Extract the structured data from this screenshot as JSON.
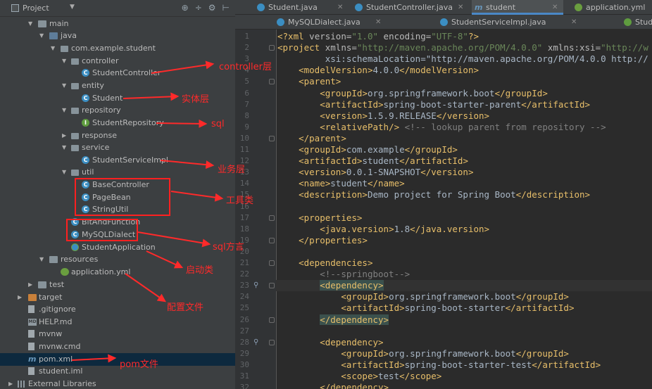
{
  "project_panel": {
    "title": "Project",
    "header_icons": [
      "globe-icon",
      "divide-icon",
      "gear-icon",
      "hide-icon"
    ],
    "tree": [
      {
        "label": "main",
        "icon": "folder-icon"
      },
      {
        "label": "java",
        "icon": "source-folder-icon"
      },
      {
        "label": "com.example.student",
        "icon": "package-icon"
      },
      {
        "label": "controller",
        "icon": "package-icon"
      },
      {
        "label": "StudentController",
        "icon": "class-icon"
      },
      {
        "label": "entity",
        "icon": "package-icon"
      },
      {
        "label": "Student",
        "icon": "class-icon"
      },
      {
        "label": "repository",
        "icon": "package-icon"
      },
      {
        "label": "StudentRepository",
        "icon": "interface-icon"
      },
      {
        "label": "response",
        "icon": "package-icon"
      },
      {
        "label": "service",
        "icon": "package-icon"
      },
      {
        "label": "StudentServiceImpl",
        "icon": "class-icon"
      },
      {
        "label": "util",
        "icon": "package-icon"
      },
      {
        "label": "BaseController",
        "icon": "class-icon"
      },
      {
        "label": "PageBean",
        "icon": "class-icon"
      },
      {
        "label": "StringUtil",
        "icon": "class-icon"
      },
      {
        "label": "BitAndFunction",
        "icon": "class-icon"
      },
      {
        "label": "MySQLDialect",
        "icon": "class-icon"
      },
      {
        "label": "StudentApplication",
        "icon": "spring-app-icon"
      },
      {
        "label": "resources",
        "icon": "resources-folder-icon"
      },
      {
        "label": "application.yml",
        "icon": "yaml-icon"
      },
      {
        "label": "test",
        "icon": "folder-icon"
      },
      {
        "label": "target",
        "icon": "excluded-folder-icon"
      },
      {
        "label": ".gitignore",
        "icon": "file-icon"
      },
      {
        "label": "HELP.md",
        "icon": "markdown-icon"
      },
      {
        "label": "mvnw",
        "icon": "file-icon"
      },
      {
        "label": "mvnw.cmd",
        "icon": "file-icon"
      },
      {
        "label": "pom.xml",
        "icon": "maven-icon"
      },
      {
        "label": "student.iml",
        "icon": "file-icon"
      },
      {
        "label": "External Libraries",
        "icon": "library-icon"
      }
    ],
    "selected_item": "pom.xml"
  },
  "annotations": {
    "controller": "controller层",
    "entity": "实体层",
    "repository": "sql",
    "service": "业务层",
    "util": "工具类",
    "dialect": "sql方言",
    "application": "启动类",
    "config": "配置文件",
    "pom": "pom文件",
    "color": "#ff2a2a"
  },
  "editor": {
    "tabs_row1": [
      {
        "label": "Student.java",
        "icon": "class-icon"
      },
      {
        "label": "StudentController.java",
        "icon": "class-icon"
      },
      {
        "label": "student",
        "icon": "maven-icon",
        "active": true
      },
      {
        "label": "application.yml",
        "icon": "yaml-icon"
      }
    ],
    "tabs_row2": [
      {
        "label": "MySQLDialect.java",
        "icon": "class-icon"
      },
      {
        "label": "StudentServiceImpl.java",
        "icon": "class-icon"
      },
      {
        "label": "Stud",
        "icon": "interface-icon"
      }
    ],
    "line_numbers": [
      "1",
      "2",
      "3",
      "4",
      "5",
      "6",
      "7",
      "8",
      "9",
      "10",
      "11",
      "12",
      "13",
      "14",
      "15",
      "16",
      "17",
      "18",
      "19",
      "20",
      "21",
      "22",
      "23",
      "24",
      "25",
      "26",
      "27",
      "28",
      "29",
      "30",
      "31",
      "32"
    ],
    "code_lines": [
      "<?xml version=\"1.0\" encoding=\"UTF-8\"?>",
      "<project xmlns=\"http://maven.apache.org/POM/4.0.0\" xmlns:xsi=\"http://w",
      "         xsi:schemaLocation=\"http://maven.apache.org/POM/4.0.0 http://",
      "    <modelVersion>4.0.0</modelVersion>",
      "    <parent>",
      "        <groupId>org.springframework.boot</groupId>",
      "        <artifactId>spring-boot-starter-parent</artifactId>",
      "        <version>1.5.9.RELEASE</version>",
      "        <relativePath/> <!-- lookup parent from repository -->",
      "    </parent>",
      "    <groupId>com.example</groupId>",
      "    <artifactId>student</artifactId>",
      "    <version>0.0.1-SNAPSHOT</version>",
      "    <name>student</name>",
      "    <description>Demo project for Spring Boot</description>",
      "",
      "    <properties>",
      "        <java.version>1.8</java.version>",
      "    </properties>",
      "",
      "    <dependencies>",
      "        <!--springboot-->",
      "        <dependency>",
      "            <groupId>org.springframework.boot</groupId>",
      "            <artifactId>spring-boot-starter</artifactId>",
      "        </dependency>",
      "",
      "        <dependency>",
      "            <groupId>org.springframework.boot</groupId>",
      "            <artifactId>spring-boot-starter-test</artifactId>",
      "            <scope>test</scope>",
      "        </dependency>"
    ],
    "current_line": 23
  }
}
